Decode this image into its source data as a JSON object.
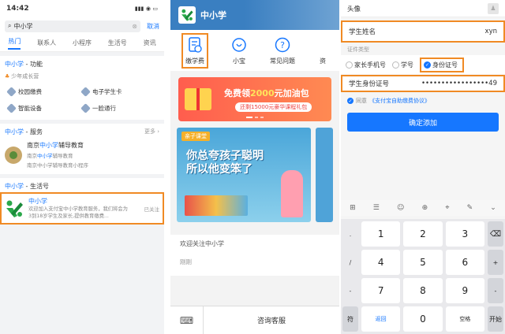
{
  "panel1": {
    "status": {
      "time": "14:42",
      "icons": "▮▮▮ ◉ ▭"
    },
    "search": {
      "query": "中小学",
      "cancel": "取消"
    },
    "tabs": [
      "热门",
      "联系人",
      "小程序",
      "生活号",
      "资讯"
    ],
    "func": {
      "title_a": "中小学",
      "title_b": " - 功能",
      "sub": "少年成长营",
      "items": [
        "校园缴费",
        "电子学生卡",
        "智能设备",
        "一脸通行"
      ]
    },
    "service": {
      "title_a": "中小学",
      "title_b": " - 服务",
      "more": "更多",
      "name_a": "南京",
      "name_hl": "中小学",
      "name_b": "辅导教育",
      "desc1_a": "南京",
      "desc1_hl": "中小学",
      "desc1_b": "辅导教育",
      "desc2": "南京中小学辅导教育小程序"
    },
    "life": {
      "title_a": "中小学",
      "title_b": " - 生活号",
      "name": "中小学",
      "desc": "欢迎加入支付宝中小学教育服务，我们将会为3到18岁学生及家长,提供教育缴费...",
      "tag": "已关注"
    }
  },
  "panel2": {
    "header_title": "中小学",
    "quick": [
      "缴学费",
      "小宝",
      "常见问题",
      "资"
    ],
    "banner": {
      "main_a": "免费领",
      "main_hl": "2000",
      "main_b": "元加油包",
      "sub": "还剩15000元豪华课程礼包"
    },
    "card": {
      "tag": "亲子课堂",
      "text": "你总夸孩子聪明 所以他变笨了"
    },
    "welcome": "欢迎关注中小学",
    "welcome_sub": "刚刚",
    "footer": {
      "kb": "⌨",
      "cs": "咨询客服"
    }
  },
  "panel3": {
    "avatar_label": "头像",
    "name_label": "学生姓名",
    "name_value": "xyn",
    "id_type_label": "证件类型",
    "radios": [
      "家长手机号",
      "学号",
      "身份证号"
    ],
    "id_label": "学生身份证号",
    "id_value": "•••••••••••••••••49",
    "agree_a": "同意",
    "agree_link": "《支付宝自助缴费协议》",
    "submit": "确定添加",
    "toolbar": [
      "⊞",
      "☰",
      "☺",
      "⊕",
      "⌖",
      "✎",
      "⌄"
    ],
    "side_keys": [
      ".",
      "/",
      "-",
      "-"
    ],
    "keys": [
      "1",
      "2",
      "3",
      "4",
      "5",
      "6",
      "7",
      "8",
      "9",
      "符",
      "返回",
      "0",
      "空格",
      "开始"
    ],
    "backspace": "⌫",
    "right_keys": [
      "⌫",
      "+",
      "-",
      "开始"
    ],
    "left_bottom": "符"
  },
  "colors": {
    "accent": "#1677ff",
    "highlight": "#f08a24"
  }
}
